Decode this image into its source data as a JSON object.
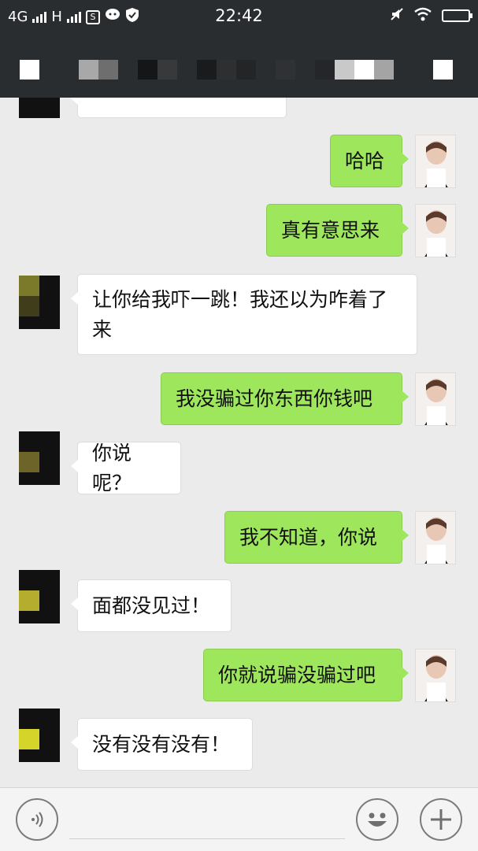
{
  "status_bar": {
    "network_label": "4G",
    "network2_label": "H",
    "time": "22:42",
    "icons": [
      "signal-icon",
      "notification-s-icon",
      "chat-bubble-icon",
      "shield-icon",
      "mute-icon",
      "wifi-icon",
      "battery-icon"
    ]
  },
  "header": {
    "back_icon": "back-icon",
    "more_icon": "more-icon",
    "title_note": ""
  },
  "messages": [
    {
      "side": "me",
      "text": "哈哈"
    },
    {
      "side": "me",
      "text": "真有意思来"
    },
    {
      "side": "other",
      "line1": "让你给我吓一跳！我还以为咋着了",
      "line2": "来"
    },
    {
      "side": "me",
      "text": "我没骗过你东西你钱吧"
    },
    {
      "side": "other",
      "text": "你说呢？"
    },
    {
      "side": "me",
      "text": "我不知道，你说"
    },
    {
      "side": "other",
      "text": "面都没见过！"
    },
    {
      "side": "me",
      "text": "你就说骗没骗过吧"
    },
    {
      "side": "other",
      "text": "没有没有没有！"
    }
  ],
  "input_bar": {
    "voice_icon": "voice-icon",
    "emoji_icon": "emoji-icon",
    "plus_icon": "plus-icon"
  },
  "colors": {
    "header_bg": "#2a2d30",
    "chat_bg": "#ebebeb",
    "my_bubble": "#9ee65c",
    "other_bubble": "#ffffff"
  }
}
